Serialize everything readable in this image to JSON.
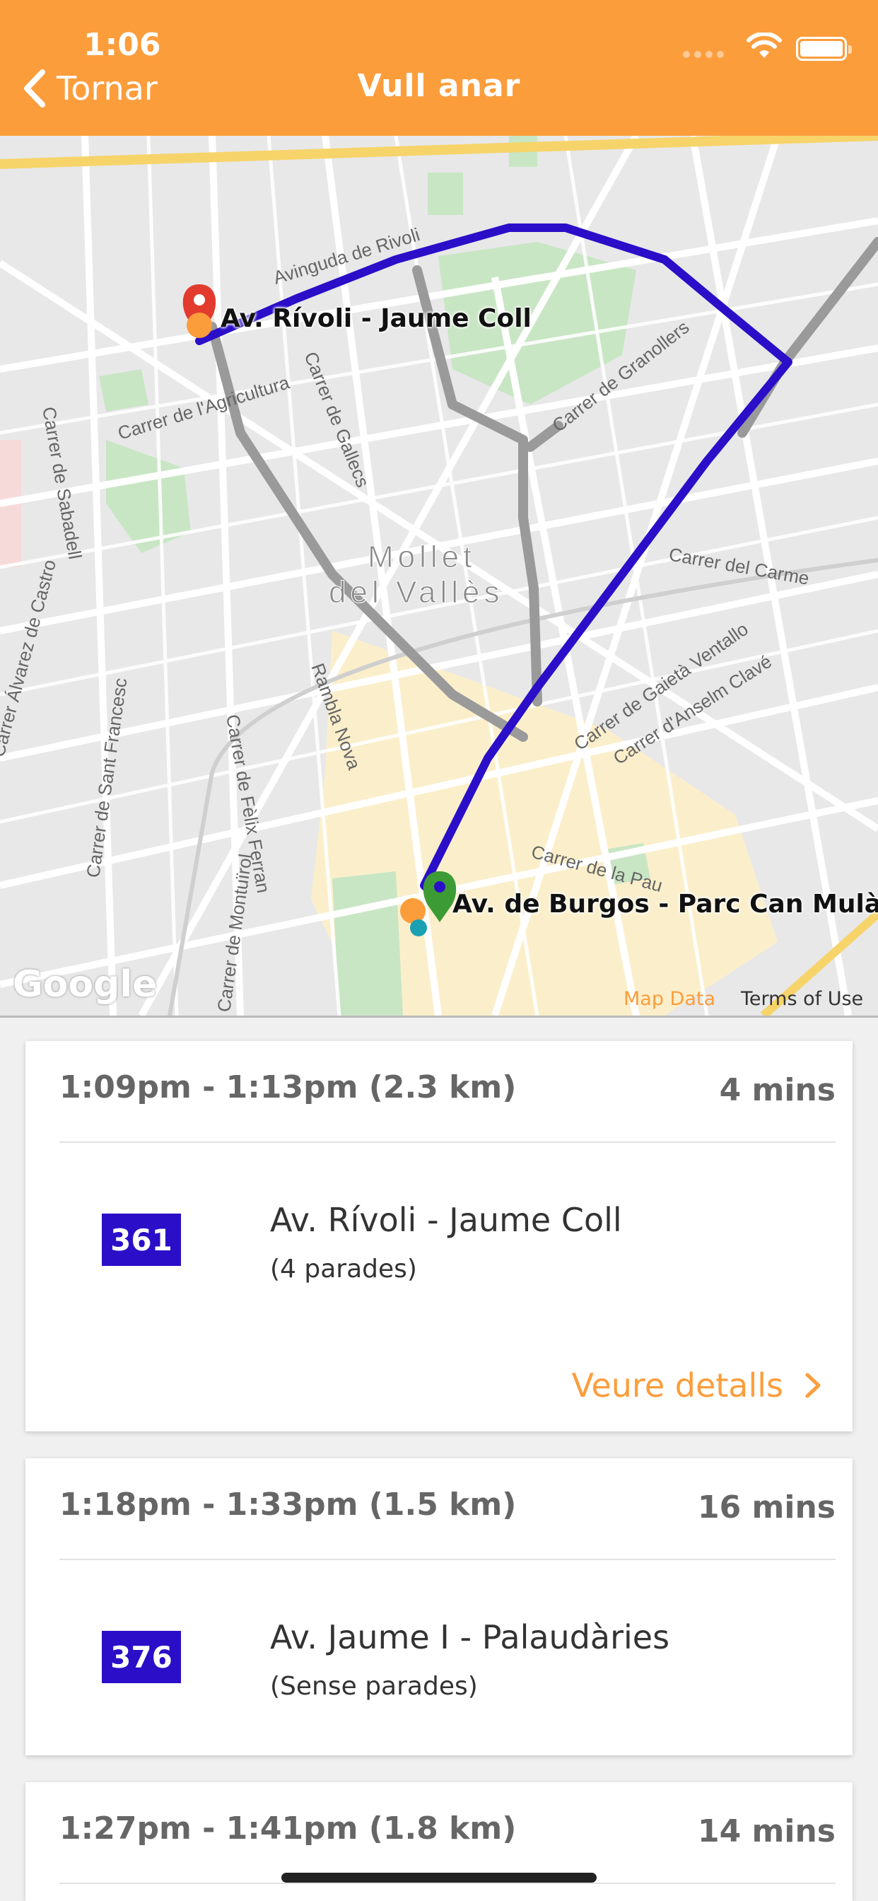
{
  "status_bar": {
    "time": "1:06"
  },
  "nav": {
    "back_label": "Tornar",
    "title": "Vull anar"
  },
  "map": {
    "origin_label": "Av. Rívoli - Jaume Coll",
    "destination_label": "Av. de Burgos - Parc Can Mulà",
    "town_label_1": "Mollet",
    "town_label_2": "del Vallès",
    "streets": [
      "Avinguda de Rivoli",
      "Carrer de l'Agricultura",
      "Carrer de Gallecs",
      "Carrer de Granollers",
      "Carrer de Sabadell",
      "Carrer del Carme",
      "Carrer de Gaietà Ventallo",
      "Carrer d'Anselm Clavé",
      "Rambla Nova",
      "Carrer de Sant Francesc",
      "Carrer de Fèlix Ferran",
      "Carrer Álvarez de Castro",
      "Carrer de la Pau",
      "Carrer de Montuïrol"
    ],
    "google": "Google",
    "map_data": "Map Data",
    "terms": "Terms of Use",
    "route_color": "#2a0ec8",
    "alt_route_color": "#9a9a9a"
  },
  "trips": [
    {
      "time_range": "1:09pm - 1:13pm (2.3 km)",
      "duration": "4 mins",
      "line": "361",
      "stop": "Av. Rívoli - Jaume Coll",
      "stops_count": "(4 parades)",
      "details_label": "Veure detalls"
    },
    {
      "time_range": "1:18pm - 1:33pm (1.5 km)",
      "duration": "16 mins",
      "line": "376",
      "stop": "Av. Jaume I - Palaudàries",
      "stops_count": "(Sense parades)"
    },
    {
      "time_range": "1:27pm - 1:41pm (1.8 km)",
      "duration": "14 mins"
    }
  ],
  "colors": {
    "accent": "#fc9d3c",
    "badge": "#2a0ec8"
  }
}
